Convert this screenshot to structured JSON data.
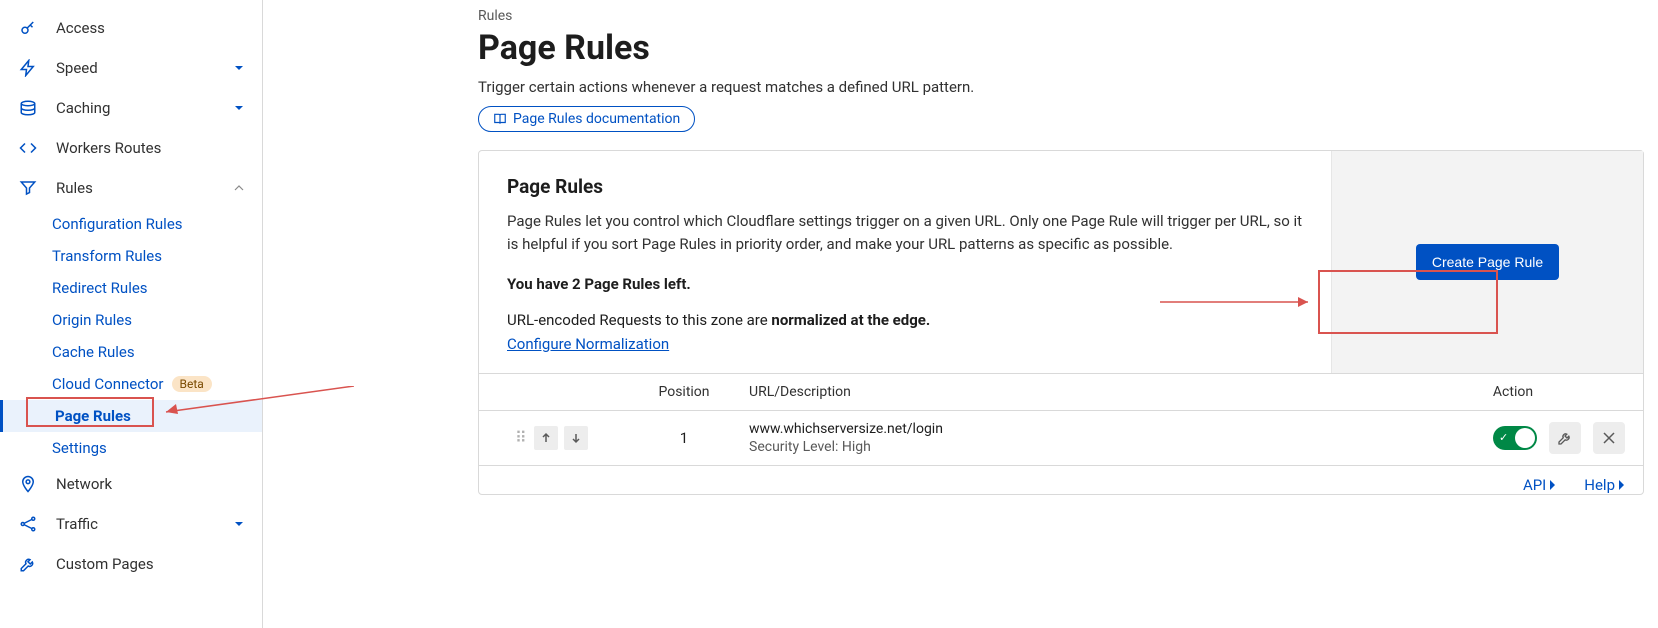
{
  "sidebar": {
    "items": [
      {
        "label": "Access",
        "icon": "key"
      },
      {
        "label": "Speed",
        "icon": "bolt",
        "chevron": "down"
      },
      {
        "label": "Caching",
        "icon": "layers",
        "chevron": "down"
      },
      {
        "label": "Workers Routes",
        "icon": "code"
      },
      {
        "label": "Rules",
        "icon": "funnel",
        "chevron": "up",
        "expanded": true
      },
      {
        "label": "Network",
        "icon": "pin"
      },
      {
        "label": "Traffic",
        "icon": "share",
        "chevron": "down"
      },
      {
        "label": "Custom Pages",
        "icon": "wrench"
      }
    ],
    "rules_children": [
      {
        "label": "Configuration Rules"
      },
      {
        "label": "Transform Rules"
      },
      {
        "label": "Redirect Rules"
      },
      {
        "label": "Origin Rules"
      },
      {
        "label": "Cache Rules"
      },
      {
        "label": "Cloud Connector",
        "beta": "Beta"
      },
      {
        "label": "Page Rules",
        "active": true
      },
      {
        "label": "Settings"
      }
    ]
  },
  "main": {
    "breadcrumb": "Rules",
    "title": "Page Rules",
    "subtitle": "Trigger certain actions whenever a request matches a defined URL pattern.",
    "doc_link": "Page Rules documentation",
    "card": {
      "heading": "Page Rules",
      "desc": "Page Rules let you control which Cloudflare settings trigger on a given URL. Only one Page Rule will trigger per URL, so it is helpful if you sort Page Rules in priority order, and make your URL patterns as specific as possible.",
      "remaining": "You have 2 Page Rules left.",
      "normalize_prefix": "URL-encoded Requests to this zone are ",
      "normalize_bold": "normalized at the edge.",
      "config_link": "Configure Normalization",
      "create_label": "Create Page Rule"
    },
    "table": {
      "headers": {
        "position": "Position",
        "url": "URL/Description",
        "action": "Action"
      },
      "rows": [
        {
          "position": "1",
          "url": "www.whichserversize.net/login",
          "desc": "Security Level: High"
        }
      ]
    },
    "footer": {
      "api": "API",
      "help": "Help"
    }
  }
}
